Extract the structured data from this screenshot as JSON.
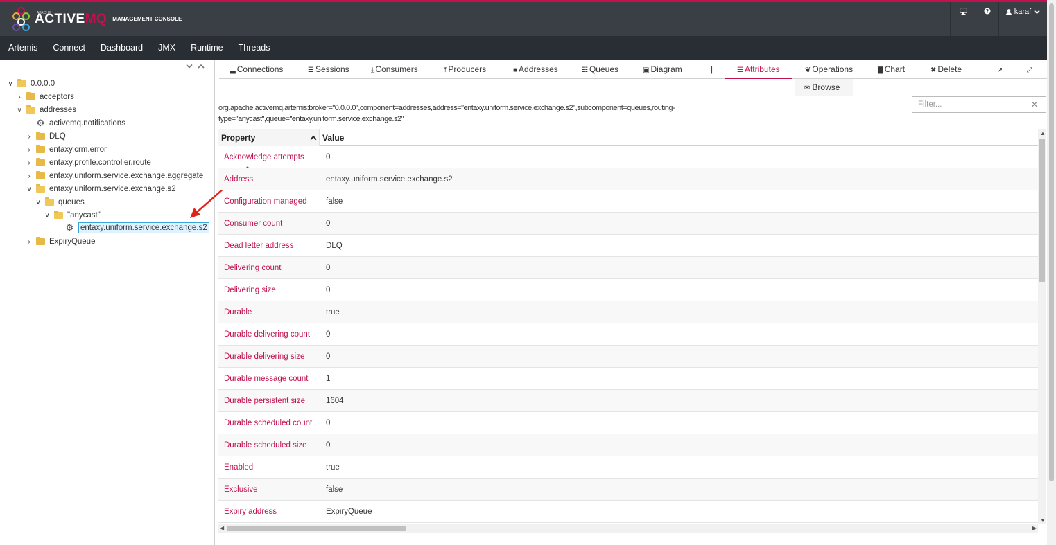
{
  "header": {
    "logo_apache": "APACHE",
    "logo_active": "ACTIVE",
    "logo_mq": "MQ",
    "logo_sub": "MANAGEMENT CONSOLE",
    "user": "karaf",
    "monitor_icon": "desktop-icon",
    "help_icon": "question-circle-icon",
    "brand_color": "#c1124e"
  },
  "nav": {
    "items": [
      "Artemis",
      "Connect",
      "Dashboard",
      "JMX",
      "Runtime",
      "Threads"
    ]
  },
  "tree": {
    "nodes": [
      {
        "label": "0.0.0.0"
      },
      {
        "label": "acceptors"
      },
      {
        "label": "addresses"
      },
      {
        "label": "activemq.notifications"
      },
      {
        "label": "DLQ"
      },
      {
        "label": "entaxy.crm.error"
      },
      {
        "label": "entaxy.profile.controller.route"
      },
      {
        "label": "entaxy.uniform.service.exchange.aggregate"
      },
      {
        "label": "entaxy.uniform.service.exchange.s2"
      },
      {
        "label": "queues"
      },
      {
        "label": "\"anycast\""
      },
      {
        "label": "entaxy.uniform.service.exchange.s2"
      },
      {
        "label": "ExpiryQueue"
      }
    ]
  },
  "tabs": {
    "connections": "Connections",
    "sessions": "Sessions",
    "consumers": "Consumers",
    "producers": "Producers",
    "addresses": "Addresses",
    "queues": "Queues",
    "diagram": "Diagram",
    "separator": "|",
    "attributes": "Attributes",
    "operations": "Operations",
    "chart": "Chart",
    "delete": "Delete",
    "browse": "Browse"
  },
  "mbean": {
    "line1": "org.apache.activemq.artemis:broker=\"0.0.0.0\",component=addresses,address=\"entaxy.uniform.service.exchange.s2\",subcomponent=queues,routing-",
    "line2": "type=\"anycast\",queue=\"entaxy.uniform.service.exchange.s2\""
  },
  "filter": {
    "placeholder": "Filter..."
  },
  "table": {
    "col_property": "Property",
    "col_value": "Value",
    "rows": [
      {
        "property": "Acknowledge attempts",
        "value": "0"
      },
      {
        "property": "Address",
        "value": "entaxy.uniform.service.exchange.s2"
      },
      {
        "property": "Configuration managed",
        "value": "false"
      },
      {
        "property": "Consumer count",
        "value": "0"
      },
      {
        "property": "Dead letter address",
        "value": "DLQ"
      },
      {
        "property": "Delivering count",
        "value": "0"
      },
      {
        "property": "Delivering size",
        "value": "0"
      },
      {
        "property": "Durable",
        "value": "true"
      },
      {
        "property": "Durable delivering count",
        "value": "0"
      },
      {
        "property": "Durable delivering size",
        "value": "0"
      },
      {
        "property": "Durable message count",
        "value": "1"
      },
      {
        "property": "Durable persistent size",
        "value": "1604"
      },
      {
        "property": "Durable scheduled count",
        "value": "0"
      },
      {
        "property": "Durable scheduled size",
        "value": "0"
      },
      {
        "property": "Enabled",
        "value": "true"
      },
      {
        "property": "Exclusive",
        "value": "false"
      },
      {
        "property": "Expiry address",
        "value": "ExpiryQueue"
      }
    ]
  }
}
